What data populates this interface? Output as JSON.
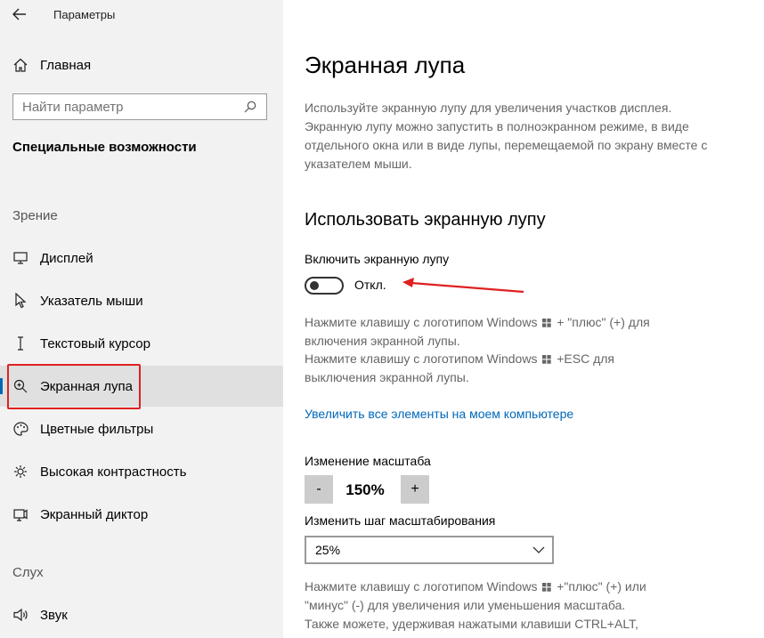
{
  "window": {
    "title": "Параметры"
  },
  "sidebar": {
    "home_label": "Главная",
    "search_placeholder": "Найти параметр",
    "category_title": "Специальные возможности",
    "section_vision": "Зрение",
    "items": [
      {
        "label": "Дисплей",
        "icon": "display-icon"
      },
      {
        "label": "Указатель мыши",
        "icon": "mouse-pointer-icon"
      },
      {
        "label": "Текстовый курсор",
        "icon": "text-cursor-icon"
      },
      {
        "label": "Экранная лупа",
        "icon": "magnifier-icon",
        "selected": true
      },
      {
        "label": "Цветные фильтры",
        "icon": "palette-icon"
      },
      {
        "label": "Высокая контрастность",
        "icon": "contrast-icon"
      },
      {
        "label": "Экранный диктор",
        "icon": "narrator-icon"
      }
    ],
    "section_hearing": "Слух",
    "hearing_items": [
      {
        "label": "Звук",
        "icon": "speaker-icon"
      }
    ]
  },
  "main": {
    "title": "Экранная лупа",
    "description": "Используйте экранную лупу для увеличения участков дисплея. Экранную лупу можно запустить в полноэкранном режиме, в виде отдельного окна или в виде лупы, перемещаемой по экрану вместе с указателем мыши.",
    "section_title": "Использовать экранную лупу",
    "toggle_label": "Включить экранную лупу",
    "toggle_state": "Откл.",
    "hint_on_prefix": "Нажмите клавишу с логотипом Windows",
    "hint_on_suffix": "+ \"плюс\" (+) для",
    "hint_on_line2": "включения экранной лупы.",
    "hint_off_prefix": "Нажмите клавишу с логотипом Windows",
    "hint_off_suffix": "+ESC для",
    "hint_off_line2": "выключения экранной лупы.",
    "link_text": "Увеличить все элементы на моем компьютере",
    "zoom_label": "Изменение масштаба",
    "zoom_minus": "-",
    "zoom_value": "150%",
    "zoom_plus": "+",
    "step_label": "Изменить шаг масштабирования",
    "step_value": "25%",
    "bottom_hint_line1_prefix": "Нажмите клавишу с логотипом Windows",
    "bottom_hint_line1_suffix": "+\"плюс\" (+) или",
    "bottom_hint_line2": "\"минус\" (-) для увеличения или уменьшения масштаба.",
    "bottom_hint_line3": "Также можете, удерживая нажатыми клавиши CTRL+ALT,"
  },
  "colors": {
    "accent": "#0067b8",
    "annotation": "#e02020",
    "sidebar_bg": "#f2f2f2",
    "selected_bg": "#e0e0e0"
  }
}
